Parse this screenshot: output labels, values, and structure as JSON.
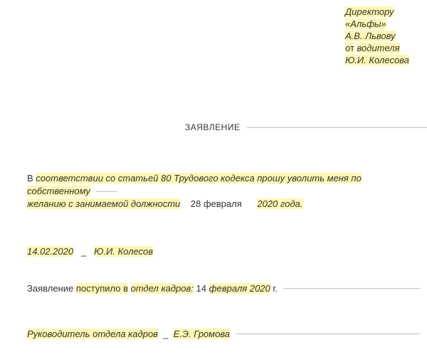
{
  "header": {
    "to_title": "Директору",
    "to_company": "«Альфы»",
    "to_name": "А.В. Львову",
    "from_label": "от",
    "from_position": "водителя",
    "from_name": "Ю.И. Колесова"
  },
  "title": "ЗАЯВЛЕНИЕ",
  "body": {
    "prefix": "В",
    "text1": "соответствии со статьей 80 Трудового кодекса прошу уволить меня по собственному",
    "text2": "желанию с занимаемой должности",
    "day": "28 февраля",
    "year": "2020 года."
  },
  "date_block": {
    "date": "14.02.2020",
    "sep": "_",
    "name": "Ю.И. Колесов"
  },
  "received": {
    "prefix": "Заявление",
    "mid": "поступило в",
    "dept": "отдел кадров:",
    "date_part": "14",
    "month_year": "февраля 2020",
    "suffix": "г."
  },
  "hr_head": {
    "label": "Руководитель отдела кадров",
    "sep": "_",
    "name": "Е.Э. Громова"
  }
}
